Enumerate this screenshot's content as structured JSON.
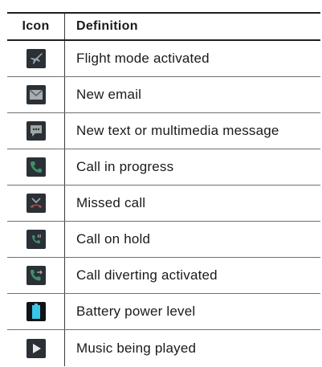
{
  "header": {
    "icon_label": "Icon",
    "definition_label": "Definition"
  },
  "rows": [
    {
      "icon": "airplane-icon",
      "definition": "Flight mode activated"
    },
    {
      "icon": "envelope-icon",
      "definition": "New email"
    },
    {
      "icon": "message-bubble-icon",
      "definition": "New text or multimedia message"
    },
    {
      "icon": "phone-handset-icon",
      "definition": "Call in progress"
    },
    {
      "icon": "missed-call-icon",
      "definition": "Missed call"
    },
    {
      "icon": "call-hold-icon",
      "definition": "Call on hold"
    },
    {
      "icon": "call-divert-icon",
      "definition": "Call diverting activated"
    },
    {
      "icon": "battery-icon",
      "definition": "Battery power level"
    },
    {
      "icon": "play-icon",
      "definition": "Music being played"
    }
  ],
  "colors": {
    "icon_background": "#2a3036",
    "icon_glyph": "#9aa3a8",
    "phone_green": "#3f8f6a",
    "missed_red": "#b04a4a",
    "battery_cyan": "#39c6e8"
  }
}
